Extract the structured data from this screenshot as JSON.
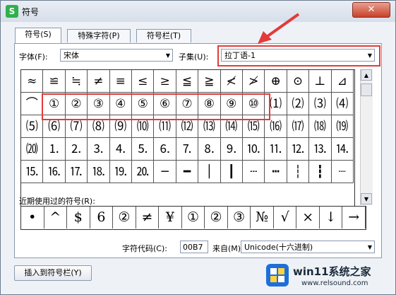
{
  "window": {
    "title": "符号",
    "app_icon": "S",
    "close_glyph": "✕"
  },
  "tabs": [
    {
      "label": "符号(S)"
    },
    {
      "label": "特殊字符(P)"
    },
    {
      "label": "符号栏(T)"
    }
  ],
  "font": {
    "label": "字体(F):",
    "value": "宋体"
  },
  "subset": {
    "label": "子集(U):",
    "value": "拉丁语-1"
  },
  "symbol_grid": [
    [
      "≈",
      "≌",
      "≒",
      "≠",
      "≡",
      "≤",
      "≥",
      "≦",
      "≧",
      "≮",
      "≯",
      "⊕",
      "⊙",
      "⊥",
      "⊿"
    ],
    [
      "⌒",
      "①",
      "②",
      "③",
      "④",
      "⑤",
      "⑥",
      "⑦",
      "⑧",
      "⑨",
      "⑩",
      "⑴",
      "⑵",
      "⑶",
      "⑷"
    ],
    [
      "⑸",
      "⑹",
      "⑺",
      "⑻",
      "⑼",
      "⑽",
      "⑾",
      "⑿",
      "⒀",
      "⒁",
      "⒂",
      "⒃",
      "⒄",
      "⒅",
      "⒆"
    ],
    [
      "⒇",
      "⒈",
      "⒉",
      "⒊",
      "⒋",
      "⒌",
      "⒍",
      "⒎",
      "⒏",
      "⒐",
      "⒑",
      "⒒",
      "⒓",
      "⒔",
      "⒕"
    ],
    [
      "⒖",
      "⒗",
      "⒘",
      "⒙",
      "⒚",
      "⒛",
      "─",
      "━",
      "│",
      "┃",
      "┄",
      "┅",
      "┆",
      "┇",
      "┈"
    ]
  ],
  "recent": {
    "label": "近期使用过的符号(R):",
    "symbols": [
      "•",
      "^",
      "$",
      "6",
      "②",
      "≠",
      "¥",
      "①",
      "②",
      "③",
      "№",
      "√",
      "×",
      "↓",
      "→"
    ]
  },
  "char_code": {
    "label": "字符代码(C):",
    "value": "00B7"
  },
  "from": {
    "label": "来自(M)",
    "value": "Unicode(十六进制)"
  },
  "insert_button": {
    "label": "插入到符号栏(Y)"
  },
  "watermark": {
    "title": "win11系统之家",
    "url": "www.relsound.com"
  },
  "colors": {
    "highlight": "#e23b3b",
    "accent": "#2fb04b"
  }
}
